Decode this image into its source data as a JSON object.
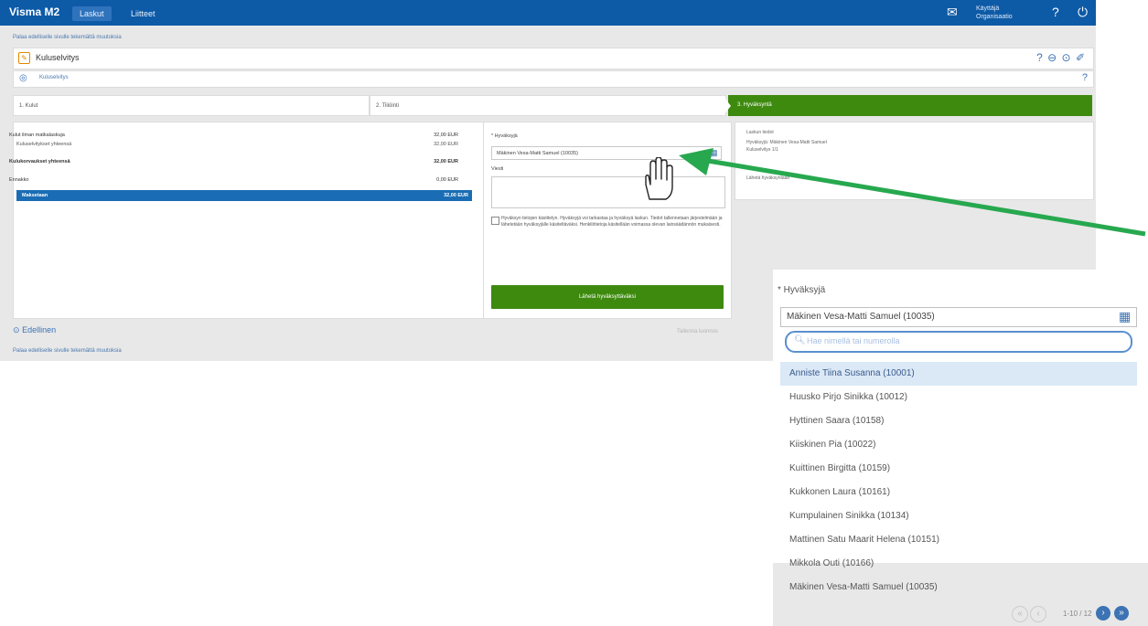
{
  "topbar": {
    "app_title": "Visma M2",
    "tabs": [
      "Laskut",
      "Liitteet"
    ],
    "user": "Käyttäjä",
    "user_sub": "Organisaatio"
  },
  "notes": {
    "top": "Palaa edelliselle sivulle tekemättä muutoksia",
    "bottom": "Palaa edelliselle sivulle tekemättä muutoksia"
  },
  "titlebar": {
    "title": "Kuluselvitys"
  },
  "subbar": {
    "text": "Kuluselvitys"
  },
  "steps": [
    "1. Kulut",
    "2. Tiliöinti",
    "3. Hyväksyntä"
  ],
  "summary": {
    "rows": [
      {
        "label": "Kulut ilman matkalaskuja",
        "value": "32,00 EUR",
        "bold": false
      },
      {
        "label": "Kuluselvitykset yhteensä",
        "value": "32,00 EUR",
        "bold": false
      },
      {
        "label": "Kulukorvaukset yhteensä",
        "value": "32,00 EUR",
        "bold": true
      },
      {
        "label": "Ennakko",
        "value": "0,00 EUR",
        "bold": false
      },
      {
        "label": "Maksetaan",
        "value": "32,00 EUR",
        "bold": true
      }
    ]
  },
  "form": {
    "approver_label": "* Hyväksyjä",
    "approver_value": "Mäkinen Vesa-Matti Samuel (10035)",
    "message_label": "Viesti",
    "checkbox_text": "Hyväksyn tietojen käsittelyn. Hyväksyjä voi tarkastaa ja hyväksyä laskun. Tiedot tallennetaan järjestelmään ja lähetetään hyväksyjälle käsiteltäväksi. Henkilötietoja käsitellään voimassa olevan lainsäädännön mukaisesti.",
    "send_button": "Lähetä hyväksyttäväksi"
  },
  "info": {
    "lines": [
      "Laskun tiedot",
      "Hyväksyjä: Mäkinen Vesa-Matti Samuel",
      "Kuluselvitys 1/1",
      "Lähetä hyväksyntään"
    ]
  },
  "bottom": {
    "prev": "Edellinen",
    "right": "Tallenna luonnos"
  },
  "zoom": {
    "label": "* Hyväksyjä",
    "selected": "Mäkinen Vesa-Matti Samuel (10035)",
    "search_placeholder": "Hae nimellä tai numerolla",
    "items": [
      "Anniste Tiina Susanna (10001)",
      "Huusko Pirjo Sinikka (10012)",
      "Hyttinen Saara (10158)",
      "Kiiskinen Pia (10022)",
      "Kuittinen Birgitta (10159)",
      "Kukkonen Laura (10161)",
      "Kumpulainen Sinikka (10134)",
      "Mattinen Satu Maarit Helena (10151)",
      "Mikkola Outi (10166)",
      "Mäkinen Vesa-Matti Samuel (10035)"
    ],
    "page_info": "1-10 / 12"
  },
  "colors": {
    "brand_blue": "#0d5aa7",
    "green": "#3d8a0f",
    "selection_blue": "#1a6db4"
  }
}
